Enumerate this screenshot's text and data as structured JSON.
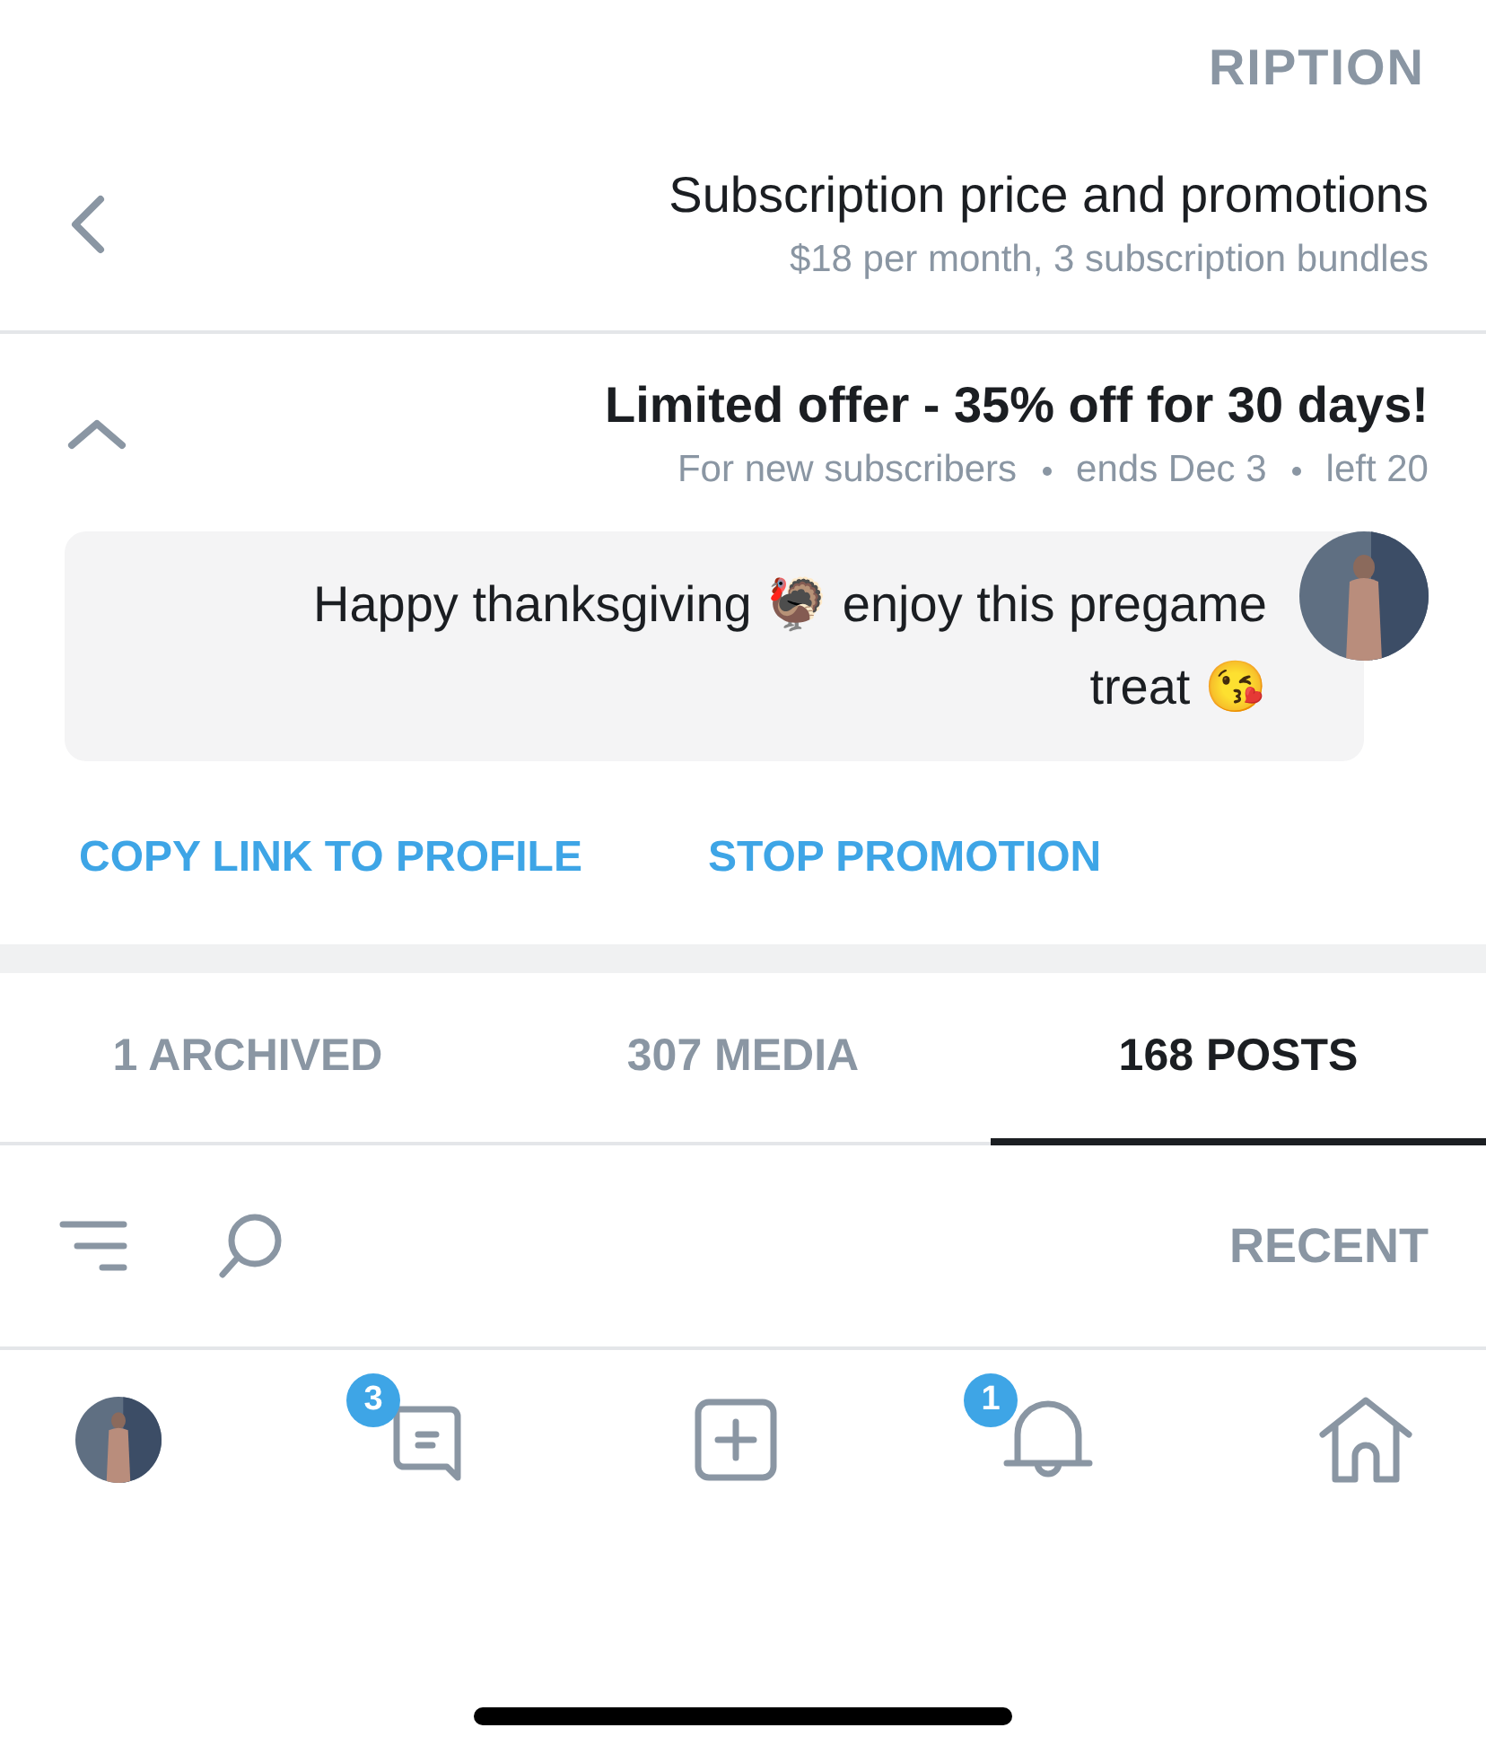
{
  "header": {
    "title": "RIPTION"
  },
  "subscription": {
    "title": "Subscription price and promotions",
    "subtitle": "$18 per month, 3 subscription bundles"
  },
  "offer": {
    "title": "Limited offer - 35% off for 30 days!",
    "details": [
      "For new subscribers",
      "ends Dec 3",
      "left 20"
    ],
    "expanded": true,
    "message": "Happy thanksgiving 🦃 enjoy this pregame treat 😘",
    "actions": [
      "COPY LINK TO PROFILE",
      "STOP PROMOTION"
    ]
  },
  "tabs": [
    {
      "label": "1 ARCHIVED",
      "selected": false
    },
    {
      "label": "307 MEDIA",
      "selected": false
    },
    {
      "label": "168 POSTS",
      "selected": true
    }
  ],
  "filter": {
    "label": "RECENT"
  },
  "nav": [
    {
      "kind": "avatar"
    },
    {
      "kind": "messages",
      "badge": "3"
    },
    {
      "kind": "add"
    },
    {
      "kind": "notifications",
      "badge": "1"
    },
    {
      "kind": "home"
    }
  ]
}
